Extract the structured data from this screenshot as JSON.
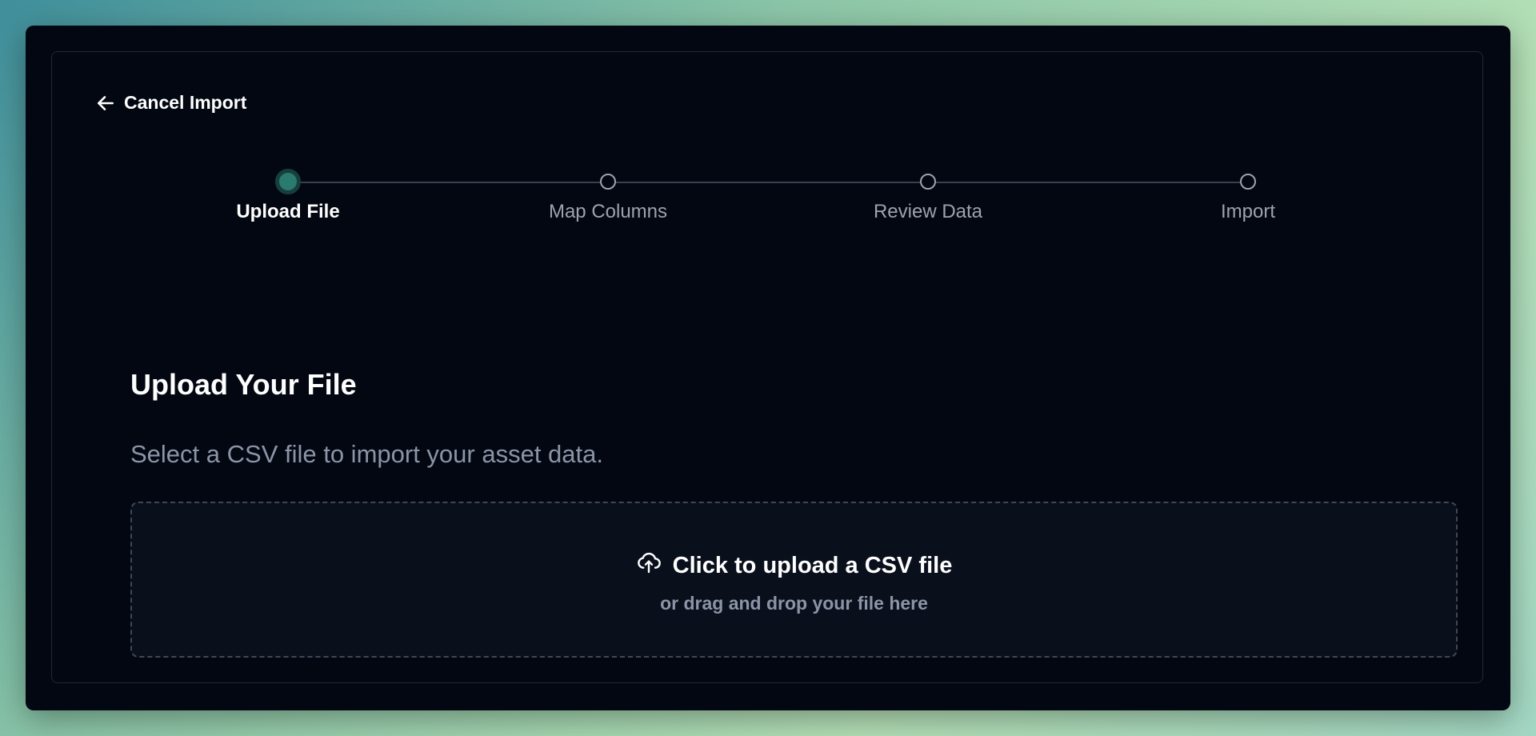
{
  "header": {
    "cancel_label": "Cancel Import",
    "back_icon": "arrow-left-icon"
  },
  "stepper": {
    "steps": [
      {
        "label": "Upload File",
        "state": "active"
      },
      {
        "label": "Map Columns",
        "state": "pending"
      },
      {
        "label": "Review Data",
        "state": "pending"
      },
      {
        "label": "Import",
        "state": "pending"
      }
    ]
  },
  "main": {
    "title": "Upload Your File",
    "description": "Select a CSV file to import your asset data.",
    "dropzone": {
      "icon": "cloud-upload-icon",
      "primary_text": "Click to upload a CSV file",
      "secondary_text": "or drag and drop your file here"
    }
  },
  "colors": {
    "background": "#030712",
    "accent": "#2a7a70",
    "muted_text": "#8b95a7",
    "border": "#1f2937"
  }
}
